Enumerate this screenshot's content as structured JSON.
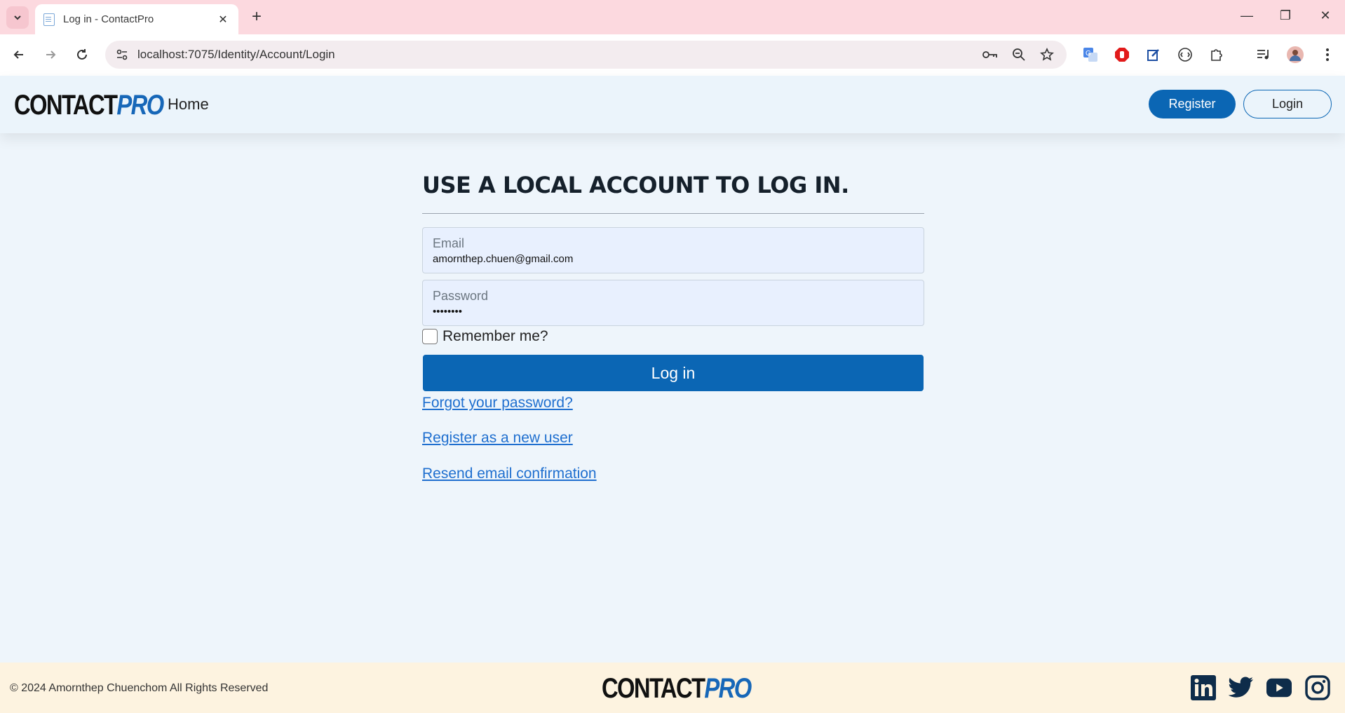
{
  "browser": {
    "tab_title": "Log in - ContactPro",
    "url": "localhost:7075/Identity/Account/Login"
  },
  "brand": {
    "part1": "CONTACT",
    "part2": "PRO"
  },
  "nav": {
    "home": "Home",
    "register": "Register",
    "login": "Login"
  },
  "form": {
    "heading": "USE A LOCAL ACCOUNT TO LOG IN.",
    "email_label": "Email",
    "email_value": "amornthep.chuen@gmail.com",
    "password_label": "Password",
    "password_value": "••••••••",
    "remember_label": "Remember me?",
    "remember_checked": false,
    "submit_label": "Log in"
  },
  "links": {
    "forgot": "Forgot your password?",
    "register_new": "Register as a new user",
    "resend": "Resend email confirmation"
  },
  "footer": {
    "copyright": "© 2024 Amornthep Chuenchom All Rights Reserved"
  },
  "colors": {
    "primary": "#0b66b4",
    "link": "#1f6fcf",
    "page_bg": "#eef5fb",
    "footer_bg": "#fdf3e0",
    "tabstrip": "#fcd9df"
  }
}
